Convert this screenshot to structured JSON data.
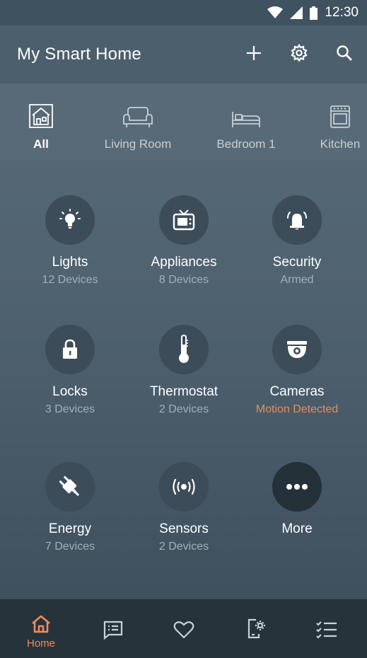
{
  "status_bar": {
    "time": "12:30",
    "icons": [
      "wifi-icon",
      "cell-signal-icon",
      "battery-icon"
    ]
  },
  "app_bar": {
    "title": "My Smart Home",
    "actions": [
      "add-icon",
      "gear-icon",
      "search-icon"
    ]
  },
  "rooms": [
    {
      "label": "All",
      "icon": "house-icon",
      "active": true
    },
    {
      "label": "Living Room",
      "icon": "sofa-icon",
      "active": false
    },
    {
      "label": "Bedroom 1",
      "icon": "bed-icon",
      "active": false
    },
    {
      "label": "Kitchen",
      "icon": "oven-icon",
      "active": false
    }
  ],
  "categories": [
    {
      "name": "Lights",
      "status": "12 Devices",
      "icon": "lightbulb-icon"
    },
    {
      "name": "Appliances",
      "status": "8 Devices",
      "icon": "tv-icon"
    },
    {
      "name": "Security",
      "status": "Armed",
      "icon": "alarm-bell-icon"
    },
    {
      "name": "Locks",
      "status": "3 Devices",
      "icon": "lock-icon"
    },
    {
      "name": "Thermostat",
      "status": "2 Devices",
      "icon": "thermometer-icon"
    },
    {
      "name": "Cameras",
      "status": "Motion Detected",
      "icon": "camera-icon",
      "alert": true
    },
    {
      "name": "Energy",
      "status": "7 Devices",
      "icon": "plug-icon"
    },
    {
      "name": "Sensors",
      "status": "2 Devices",
      "icon": "sensor-icon"
    },
    {
      "name": "More",
      "status": "",
      "icon": "more-dots-icon"
    }
  ],
  "bottom_nav": [
    {
      "label": "Home",
      "icon": "home-icon",
      "active": true
    },
    {
      "label": "",
      "icon": "messages-icon",
      "active": false
    },
    {
      "label": "",
      "icon": "heart-icon",
      "active": false
    },
    {
      "label": "",
      "icon": "device-settings-icon",
      "active": false
    },
    {
      "label": "",
      "icon": "checklist-icon",
      "active": false
    }
  ],
  "colors": {
    "accent": "#ef8b5d",
    "alert": "#e58d5e",
    "background": "#53666f",
    "nav_background": "#27333b"
  }
}
